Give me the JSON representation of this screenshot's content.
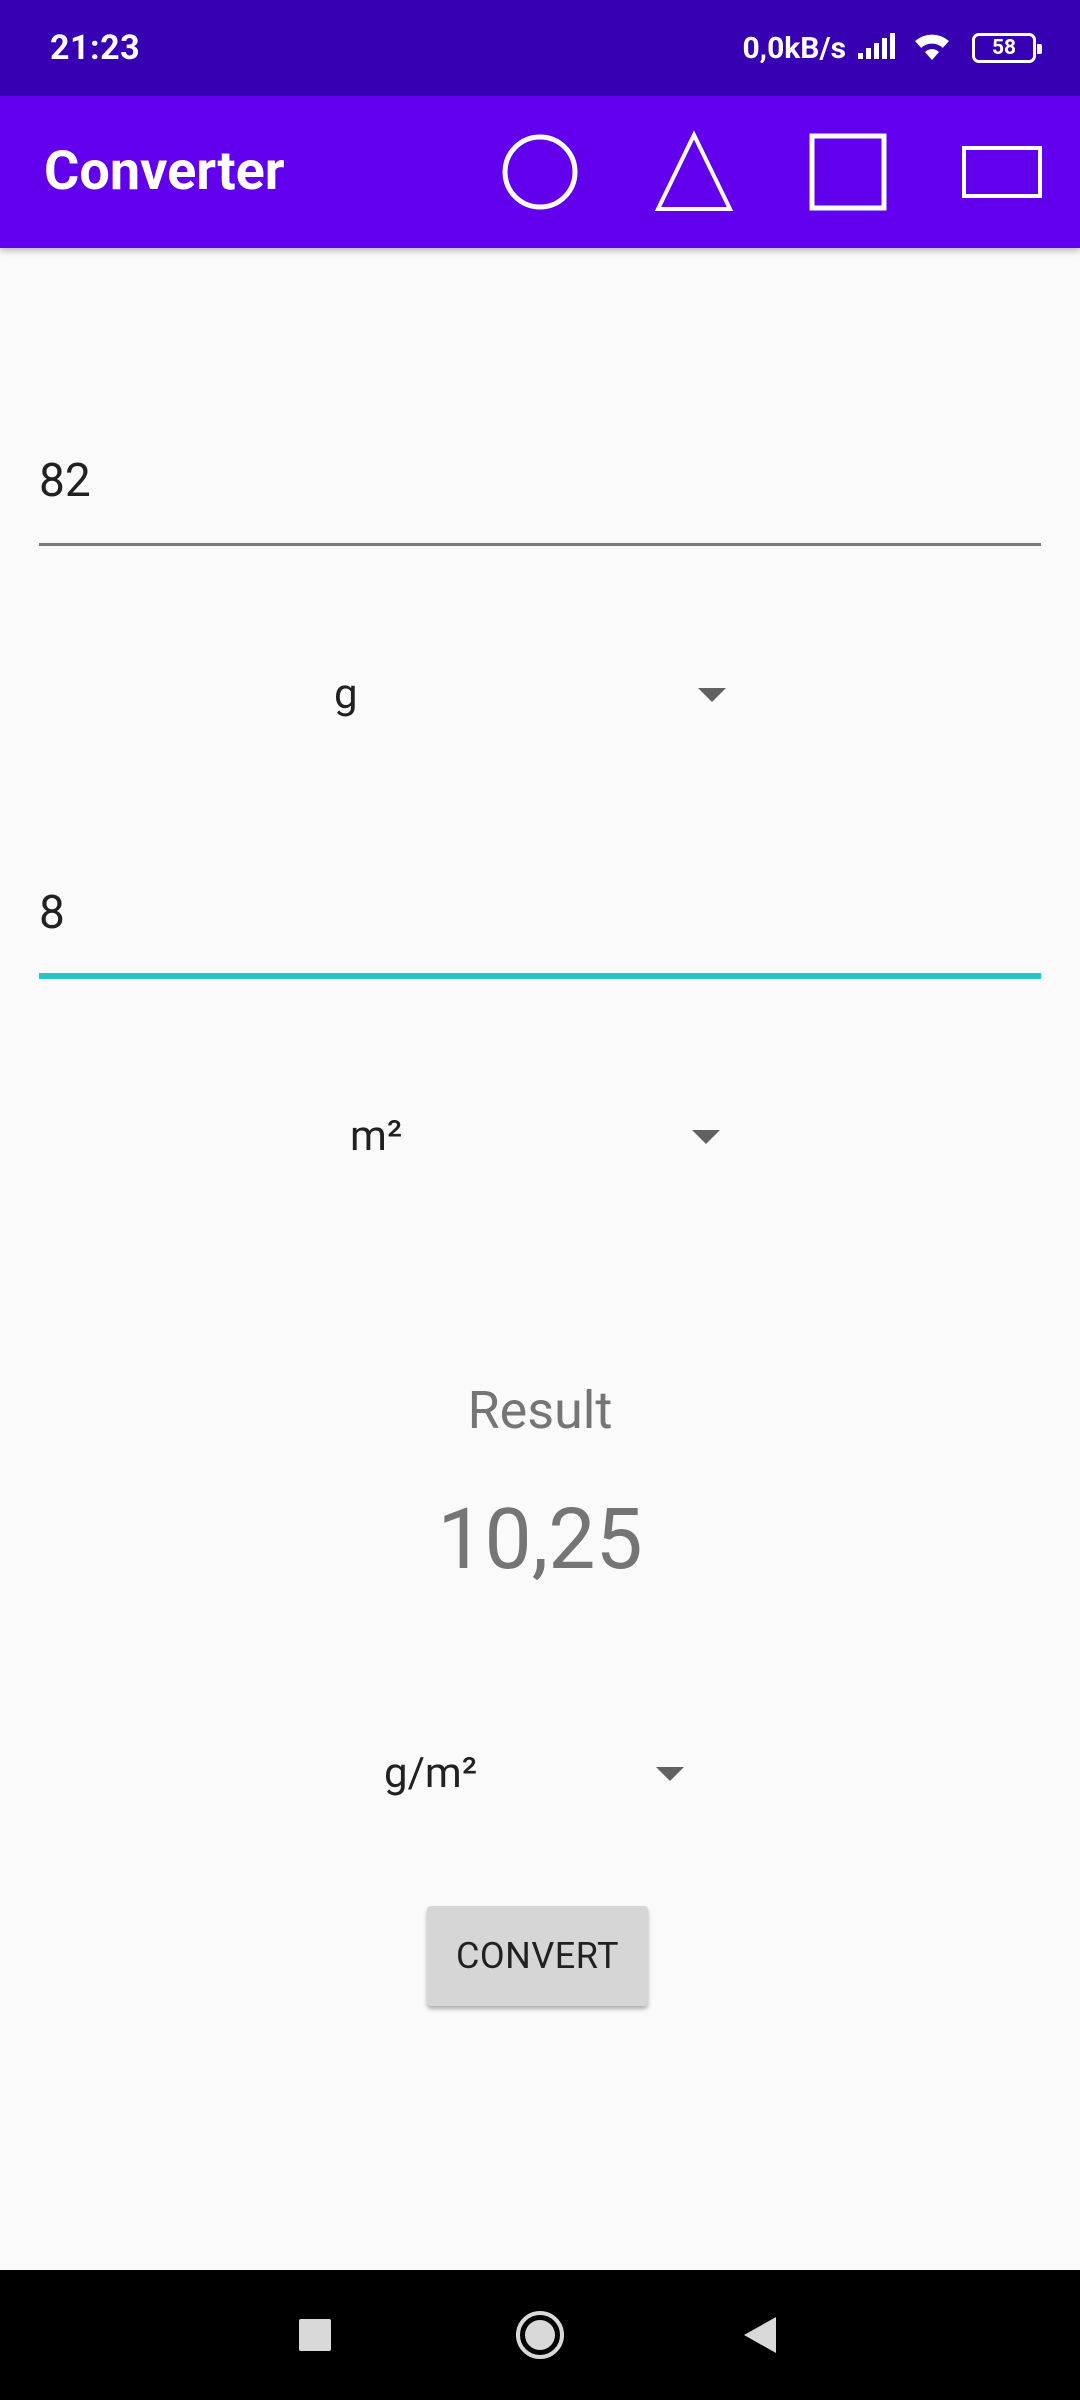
{
  "status_bar": {
    "time": "21:23",
    "network_speed": "0,0kB/s",
    "battery": "58",
    "icons": [
      "signal-icon",
      "wifi-icon",
      "battery-icon"
    ]
  },
  "app_bar": {
    "title": "Converter",
    "background_color": "#6200ee",
    "status_color": "#3700b3",
    "actions": [
      "circle-icon",
      "triangle-icon",
      "square-icon",
      "rectangle-icon"
    ]
  },
  "form": {
    "input1": {
      "value": "82"
    },
    "unit1": {
      "selected": "g"
    },
    "input2": {
      "value": "8",
      "focused": true,
      "accent_color": "#26c6c6"
    },
    "unit2": {
      "selected": "m²"
    },
    "result_label": "Result",
    "result_value": "10,25",
    "result_unit": {
      "selected": "g/m²"
    },
    "convert_button": "CONVERT"
  },
  "nav_bar": {
    "buttons": [
      "recents-square-icon",
      "home-circle-icon",
      "back-triangle-icon"
    ]
  }
}
